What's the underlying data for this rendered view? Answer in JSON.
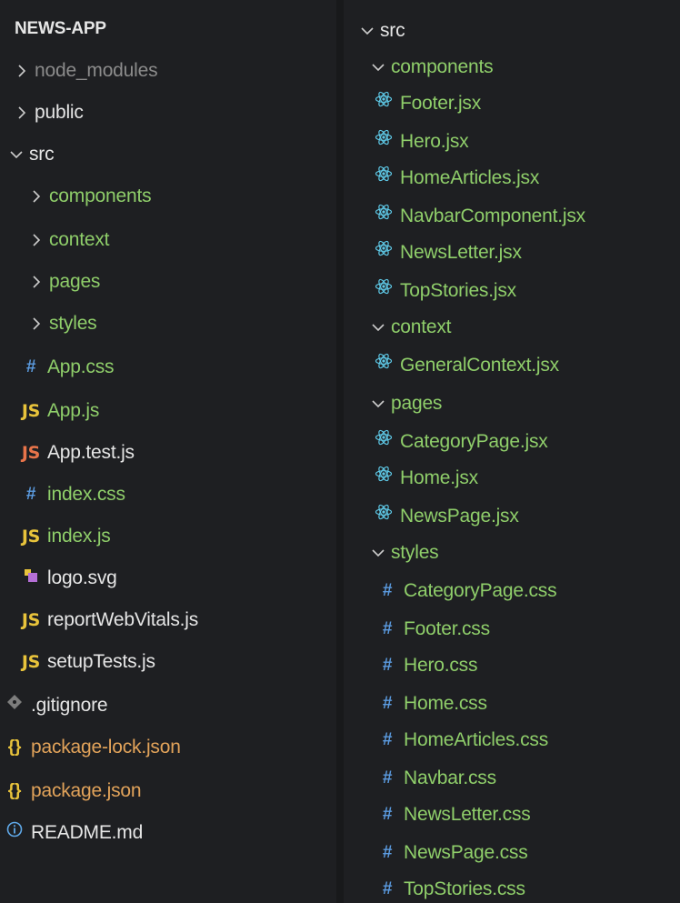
{
  "left_explorer": {
    "root_title": "NEWS-APP",
    "items": [
      {
        "label": "node_modules",
        "kind": "folder-collapsed",
        "color": "grey"
      },
      {
        "label": "public",
        "kind": "folder-collapsed",
        "color": "white"
      },
      {
        "label": "src",
        "kind": "folder-expanded",
        "color": "white"
      },
      {
        "label": "components",
        "kind": "folder-collapsed",
        "color": "green"
      },
      {
        "label": "context",
        "kind": "folder-collapsed",
        "color": "green"
      },
      {
        "label": "pages",
        "kind": "folder-collapsed",
        "color": "green"
      },
      {
        "label": "styles",
        "kind": "folder-collapsed",
        "color": "green"
      },
      {
        "label": "App.css",
        "icon": "css-hash-icon",
        "color": "green"
      },
      {
        "label": "App.js",
        "icon": "js-icon",
        "color": "green"
      },
      {
        "label": "App.test.js",
        "icon": "js-test-icon",
        "color": "white"
      },
      {
        "label": "index.css",
        "icon": "css-hash-icon",
        "color": "green"
      },
      {
        "label": "index.js",
        "icon": "js-icon",
        "color": "green"
      },
      {
        "label": "logo.svg",
        "icon": "svg-icon",
        "color": "white"
      },
      {
        "label": "reportWebVitals.js",
        "icon": "js-icon",
        "color": "white"
      },
      {
        "label": "setupTests.js",
        "icon": "js-icon",
        "color": "white"
      },
      {
        "label": ".gitignore",
        "icon": "git-icon",
        "color": "white"
      },
      {
        "label": "package-lock.json",
        "icon": "json-icon",
        "color": "orange"
      },
      {
        "label": "package.json",
        "icon": "json-icon",
        "color": "orange"
      },
      {
        "label": "README.md",
        "icon": "info-icon",
        "color": "white"
      }
    ]
  },
  "right_explorer": {
    "items": [
      {
        "label": "src",
        "kind": "folder-expanded",
        "color": "white"
      },
      {
        "label": "components",
        "kind": "folder-expanded",
        "color": "green"
      },
      {
        "label": "Footer.jsx",
        "icon": "react-icon",
        "color": "green"
      },
      {
        "label": "Hero.jsx",
        "icon": "react-icon",
        "color": "green"
      },
      {
        "label": "HomeArticles.jsx",
        "icon": "react-icon",
        "color": "green"
      },
      {
        "label": "NavbarComponent.jsx",
        "icon": "react-icon",
        "color": "green"
      },
      {
        "label": "NewsLetter.jsx",
        "icon": "react-icon",
        "color": "green"
      },
      {
        "label": "TopStories.jsx",
        "icon": "react-icon",
        "color": "green"
      },
      {
        "label": "context",
        "kind": "folder-expanded",
        "color": "green"
      },
      {
        "label": "GeneralContext.jsx",
        "icon": "react-icon",
        "color": "green"
      },
      {
        "label": "pages",
        "kind": "folder-expanded",
        "color": "green"
      },
      {
        "label": "CategoryPage.jsx",
        "icon": "react-icon",
        "color": "green"
      },
      {
        "label": "Home.jsx",
        "icon": "react-icon",
        "color": "green"
      },
      {
        "label": "NewsPage.jsx",
        "icon": "react-icon",
        "color": "green"
      },
      {
        "label": "styles",
        "kind": "folder-expanded",
        "color": "green"
      },
      {
        "label": "CategoryPage.css",
        "icon": "css-hash-icon",
        "color": "green"
      },
      {
        "label": "Footer.css",
        "icon": "css-hash-icon",
        "color": "green"
      },
      {
        "label": "Hero.css",
        "icon": "css-hash-icon",
        "color": "green"
      },
      {
        "label": "Home.css",
        "icon": "css-hash-icon",
        "color": "green"
      },
      {
        "label": "HomeArticles.css",
        "icon": "css-hash-icon",
        "color": "green"
      },
      {
        "label": "Navbar.css",
        "icon": "css-hash-icon",
        "color": "green"
      },
      {
        "label": "NewsLetter.css",
        "icon": "css-hash-icon",
        "color": "green"
      },
      {
        "label": "NewsPage.css",
        "icon": "css-hash-icon",
        "color": "green"
      },
      {
        "label": "TopStories.css",
        "icon": "css-hash-icon",
        "color": "green"
      }
    ]
  },
  "colors": {
    "background": "#1e1f22",
    "green": "#8fce6a",
    "white": "#e6e6e6",
    "grey": "#8b8b8b",
    "orange": "#e2a35a",
    "accent": "#2f7fd6"
  }
}
